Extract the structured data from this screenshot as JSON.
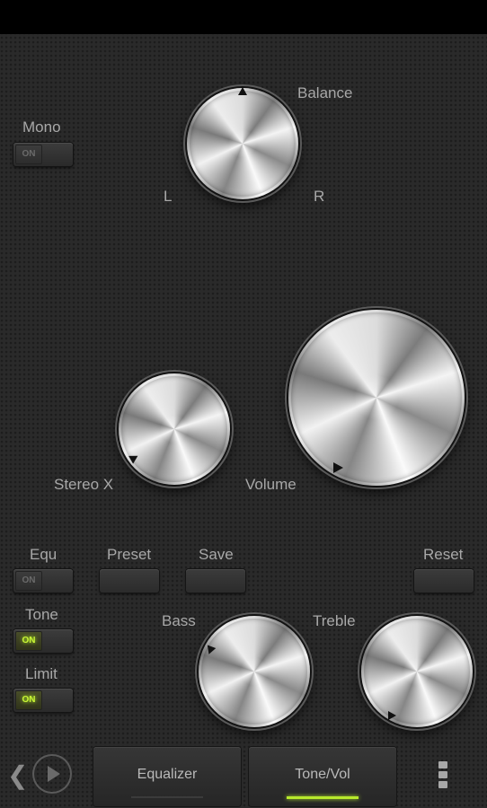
{
  "balance": {
    "label": "Balance",
    "left_label": "L",
    "right_label": "R"
  },
  "mono": {
    "label": "Mono",
    "state": "ON",
    "enabled": false
  },
  "stereo_x": {
    "label": "Stereo X"
  },
  "volume": {
    "label": "Volume"
  },
  "buttons": {
    "equ": {
      "label": "Equ",
      "state": "ON",
      "enabled": false
    },
    "preset": {
      "label": "Preset"
    },
    "save": {
      "label": "Save"
    },
    "reset": {
      "label": "Reset"
    }
  },
  "tone": {
    "label": "Tone",
    "state": "ON",
    "enabled": true
  },
  "limit": {
    "label": "Limit",
    "state": "ON",
    "enabled": true
  },
  "bass": {
    "label": "Bass"
  },
  "treble": {
    "label": "Treble"
  },
  "tabs": [
    {
      "label": "Equalizer",
      "active": false
    },
    {
      "label": "Tone/Vol",
      "active": true
    }
  ],
  "icons": {
    "back": "chevron-left-icon",
    "play": "play-circle-icon",
    "menu": "overflow-menu-icon"
  },
  "colors": {
    "accent": "#b8ea2c",
    "background": "#2a2a2a",
    "text": "#a8a8a8"
  }
}
